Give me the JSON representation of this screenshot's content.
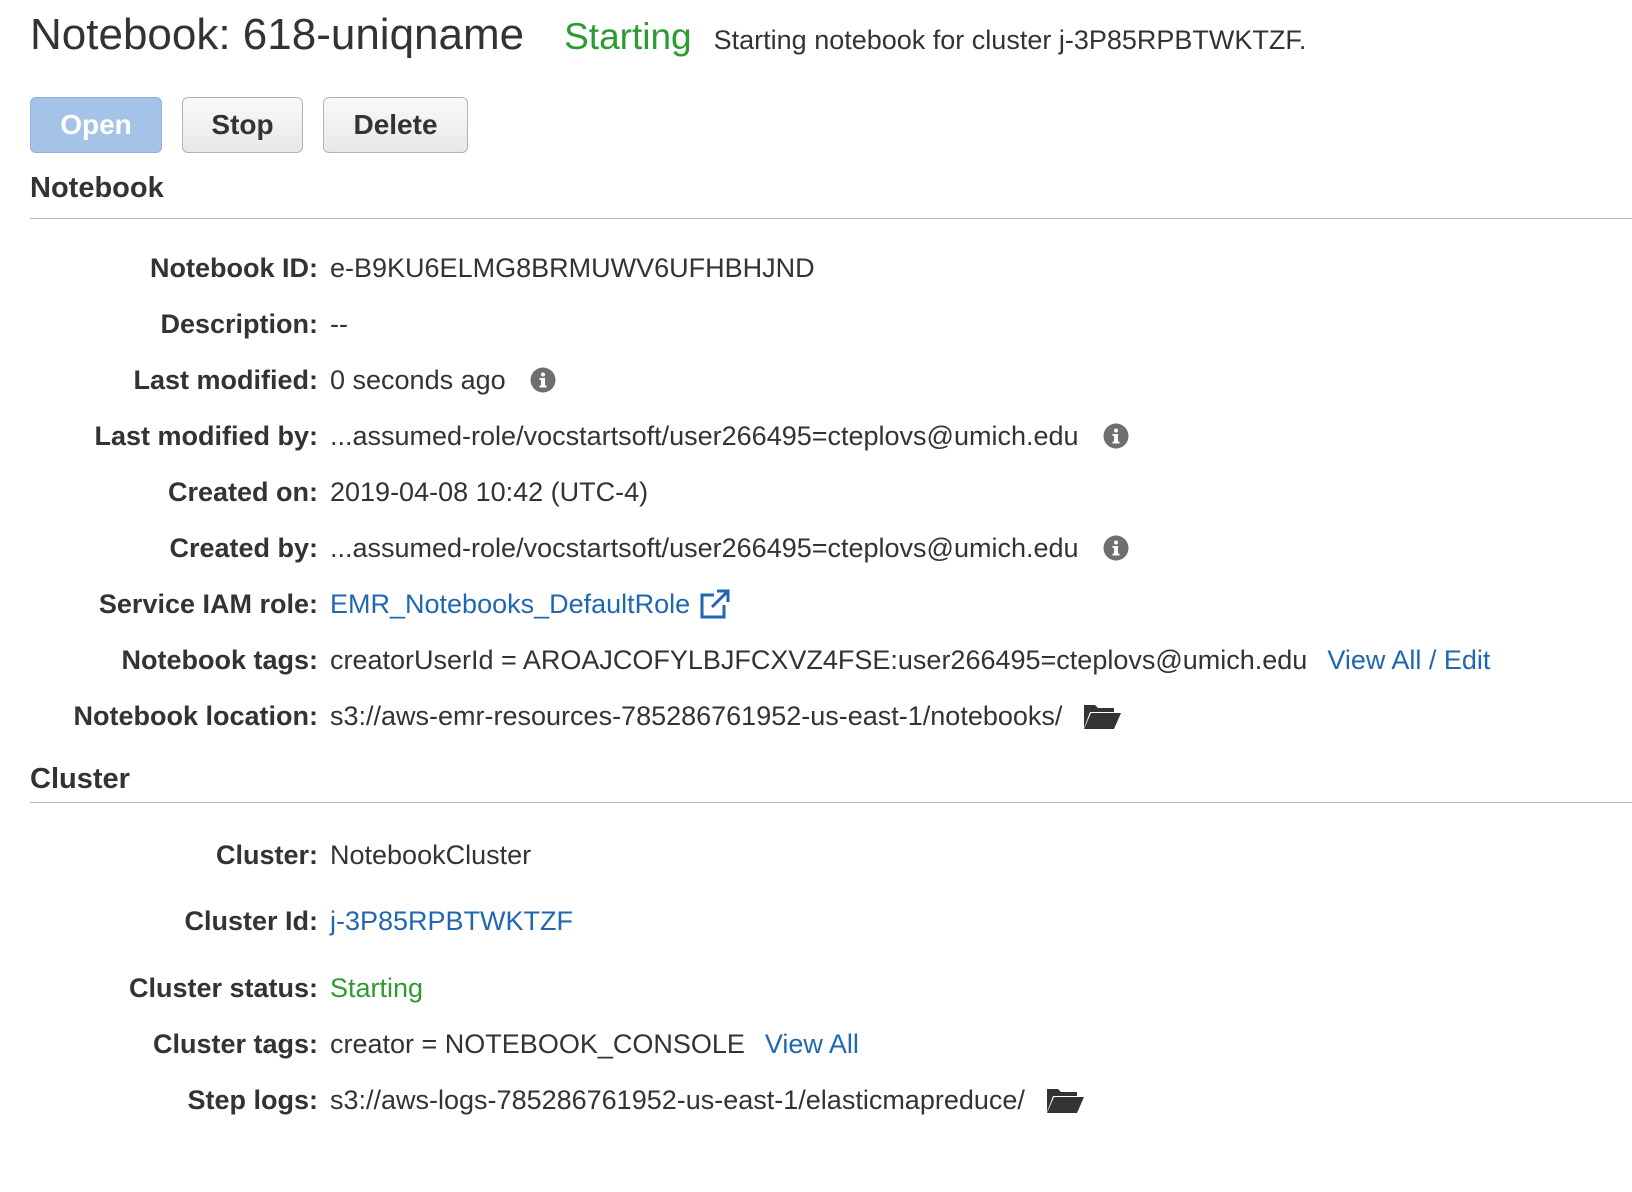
{
  "header": {
    "title": "Notebook: 618-uniqname",
    "status": "Starting",
    "status_detail": "Starting notebook for cluster j-3P85RPBTWKTZF."
  },
  "toolbar": {
    "open_label": "Open",
    "stop_label": "Stop",
    "delete_label": "Delete"
  },
  "notebook_section": {
    "title": "Notebook",
    "fields": {
      "notebook_id": {
        "label": "Notebook ID:",
        "value": "e-B9KU6ELMG8BRMUWV6UFHBHJND"
      },
      "description": {
        "label": "Description:",
        "value": "--"
      },
      "last_modified": {
        "label": "Last modified:",
        "value": "0 seconds ago"
      },
      "last_modified_by": {
        "label": "Last modified by:",
        "value": "...assumed-role/vocstartsoft/user266495=cteplovs@umich.edu"
      },
      "created_on": {
        "label": "Created on:",
        "value": "2019-04-08 10:42 (UTC-4)"
      },
      "created_by": {
        "label": "Created by:",
        "value": "...assumed-role/vocstartsoft/user266495=cteplovs@umich.edu"
      },
      "service_iam_role": {
        "label": "Service IAM role:",
        "value": "EMR_Notebooks_DefaultRole"
      },
      "notebook_tags": {
        "label": "Notebook tags:",
        "value": "creatorUserId = AROAJCOFYLBJFCXVZ4FSE:user266495=cteplovs@umich.edu",
        "link": "View All / Edit"
      },
      "notebook_location": {
        "label": "Notebook location:",
        "value": "s3://aws-emr-resources-785286761952-us-east-1/notebooks/"
      }
    }
  },
  "cluster_section": {
    "title": "Cluster",
    "fields": {
      "cluster": {
        "label": "Cluster:",
        "value": "NotebookCluster"
      },
      "cluster_id": {
        "label": "Cluster Id:",
        "value": "j-3P85RPBTWKTZF"
      },
      "cluster_status": {
        "label": "Cluster status:",
        "value": "Starting"
      },
      "cluster_tags": {
        "label": "Cluster tags:",
        "value": "creator = NOTEBOOK_CONSOLE",
        "link": "View All"
      },
      "step_logs": {
        "label": "Step logs:",
        "value": "s3://aws-logs-785286761952-us-east-1/elasticmapreduce/"
      }
    }
  },
  "colors": {
    "status_green": "#2e9b30",
    "link_blue": "#1f67b1",
    "primary_button": "#a4c3e6"
  },
  "icons": {
    "info": "info-icon",
    "external_link": "external-link-icon",
    "folder": "folder-open-icon"
  }
}
